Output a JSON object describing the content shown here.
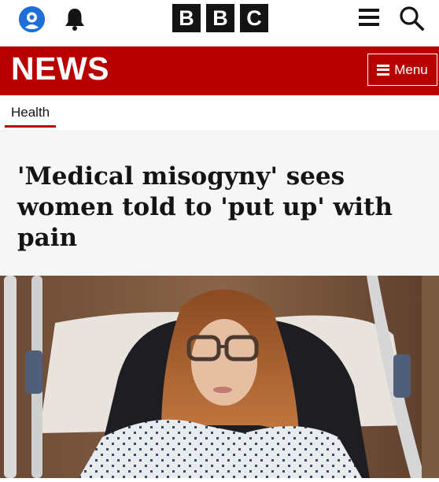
{
  "header": {
    "brand_letters": [
      "B",
      "B",
      "C"
    ],
    "account_icon": "account-icon",
    "notifications_icon": "bell-icon",
    "more_icon": "hamburger-icon",
    "search_icon": "search-icon"
  },
  "news_banner": {
    "title": "NEWS",
    "menu_label": "Menu",
    "color": "#b80000"
  },
  "section": {
    "label": "Health"
  },
  "article": {
    "headline": "'Medical misogyny' sees women told to 'put up' with pain"
  }
}
